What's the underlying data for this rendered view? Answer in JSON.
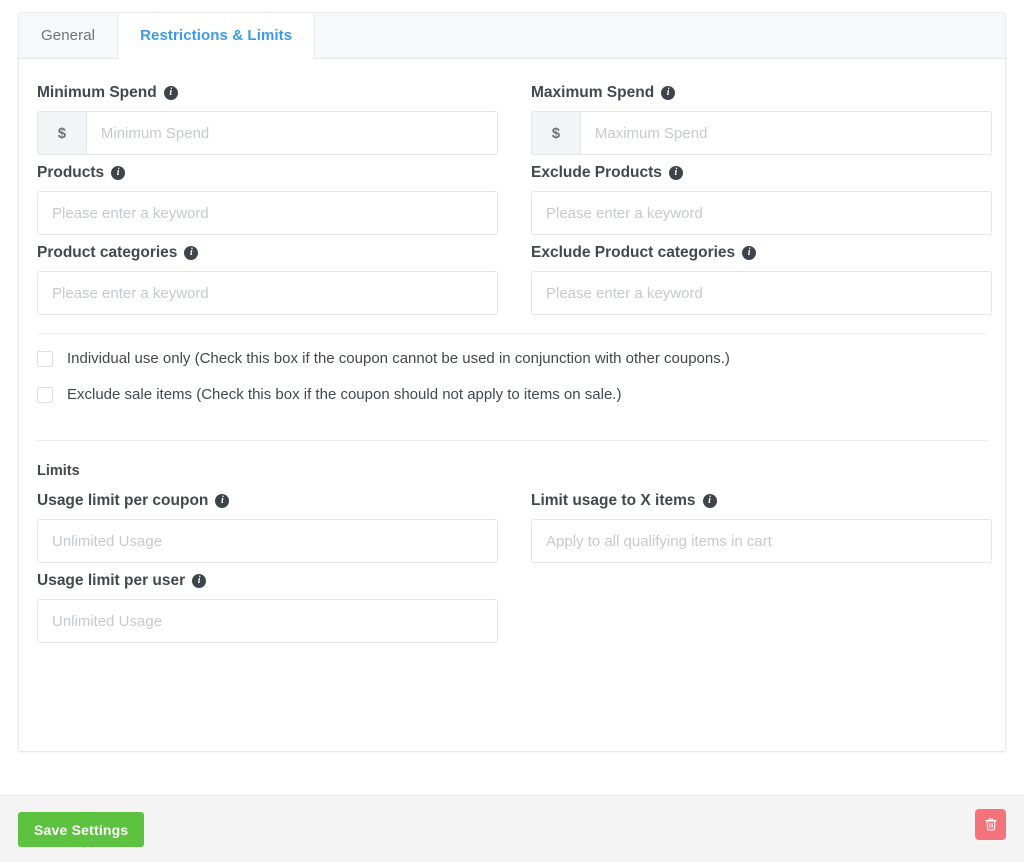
{
  "tabs": [
    {
      "id": "general",
      "label": "General",
      "active": false
    },
    {
      "id": "restrictions",
      "label": "Restrictions & Limits",
      "active": true
    }
  ],
  "icons": {
    "info": "i",
    "trash": "trash-icon"
  },
  "fields": {
    "minimum_spend": {
      "label": "Minimum Spend",
      "prefix": "$",
      "placeholder": "Minimum Spend",
      "value": ""
    },
    "maximum_spend": {
      "label": "Maximum Spend",
      "prefix": "$",
      "placeholder": "Maximum Spend",
      "value": ""
    },
    "products": {
      "label": "Products",
      "placeholder": "Please enter a keyword",
      "value": ""
    },
    "exclude_products": {
      "label": "Exclude Products",
      "placeholder": "Please enter a keyword",
      "value": ""
    },
    "product_categories": {
      "label": "Product categories",
      "placeholder": "Please enter a keyword",
      "value": ""
    },
    "exclude_product_categories": {
      "label": "Exclude Product categories",
      "placeholder": "Please enter a keyword",
      "value": ""
    },
    "usage_limit_per_coupon": {
      "label": "Usage limit per coupon",
      "placeholder": "Unlimited Usage",
      "value": ""
    },
    "limit_usage_to_x_items": {
      "label": "Limit usage to X items",
      "placeholder": "Apply to all qualifying items in cart",
      "value": ""
    },
    "usage_limit_per_user": {
      "label": "Usage limit per user",
      "placeholder": "Unlimited Usage",
      "value": ""
    }
  },
  "checkboxes": [
    {
      "id": "individual-use-only",
      "label": "Individual use only (Check this box if the coupon cannot be used in conjunction with other coupons.)",
      "checked": false
    },
    {
      "id": "exclude-sale-items",
      "label": "Exclude sale items (Check this box if the coupon should not apply to items on sale.)",
      "checked": false
    }
  ],
  "sections": {
    "limits_title": "Limits"
  },
  "footer": {
    "save_label": "Save Settings",
    "delete_label": ""
  },
  "colors": {
    "accent_blue": "#3d9ae8",
    "save_green": "#5cc23f",
    "delete_red": "#f4737a",
    "label_text": "#43484d",
    "placeholder": "#c6c9cd",
    "border": "#e4e6e9",
    "tab_bg": "#f7f8fa",
    "footer_bg": "#f4f4f4"
  }
}
